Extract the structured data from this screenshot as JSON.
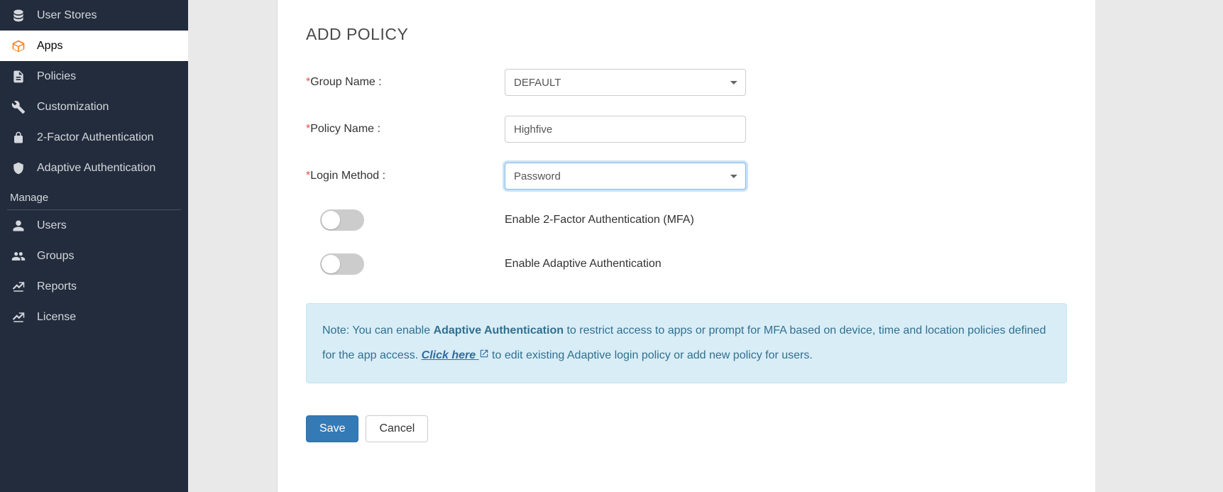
{
  "sidebar": {
    "items": [
      {
        "label": "User Stores",
        "icon": "database"
      },
      {
        "label": "Apps",
        "icon": "cube"
      },
      {
        "label": "Policies",
        "icon": "document"
      },
      {
        "label": "Customization",
        "icon": "wrench"
      },
      {
        "label": "2-Factor Authentication",
        "icon": "lock"
      },
      {
        "label": "Adaptive Authentication",
        "icon": "shield"
      }
    ],
    "manage_header": "Manage",
    "manage_items": [
      {
        "label": "Users",
        "icon": "user"
      },
      {
        "label": "Groups",
        "icon": "users"
      },
      {
        "label": "Reports",
        "icon": "chart"
      },
      {
        "label": "License",
        "icon": "chart"
      }
    ]
  },
  "page": {
    "title": "ADD POLICY",
    "group_name_label": "Group Name :",
    "group_name_value": "DEFAULT",
    "policy_name_label": "Policy Name :",
    "policy_name_value": "Highfive",
    "login_method_label": "Login Method :",
    "login_method_value": "Password",
    "toggle_mfa_label": "Enable 2-Factor Authentication (MFA)",
    "toggle_adaptive_label": "Enable Adaptive Authentication",
    "note_prefix": "Note: You can enable ",
    "note_bold": "Adaptive Authentication",
    "note_mid": " to restrict access to apps or prompt for MFA based on device, time and location policies defined for the app access. ",
    "note_link": "Click here",
    "note_suffix": " to edit existing Adaptive login policy or add new policy for users.",
    "save_label": "Save",
    "cancel_label": "Cancel"
  }
}
